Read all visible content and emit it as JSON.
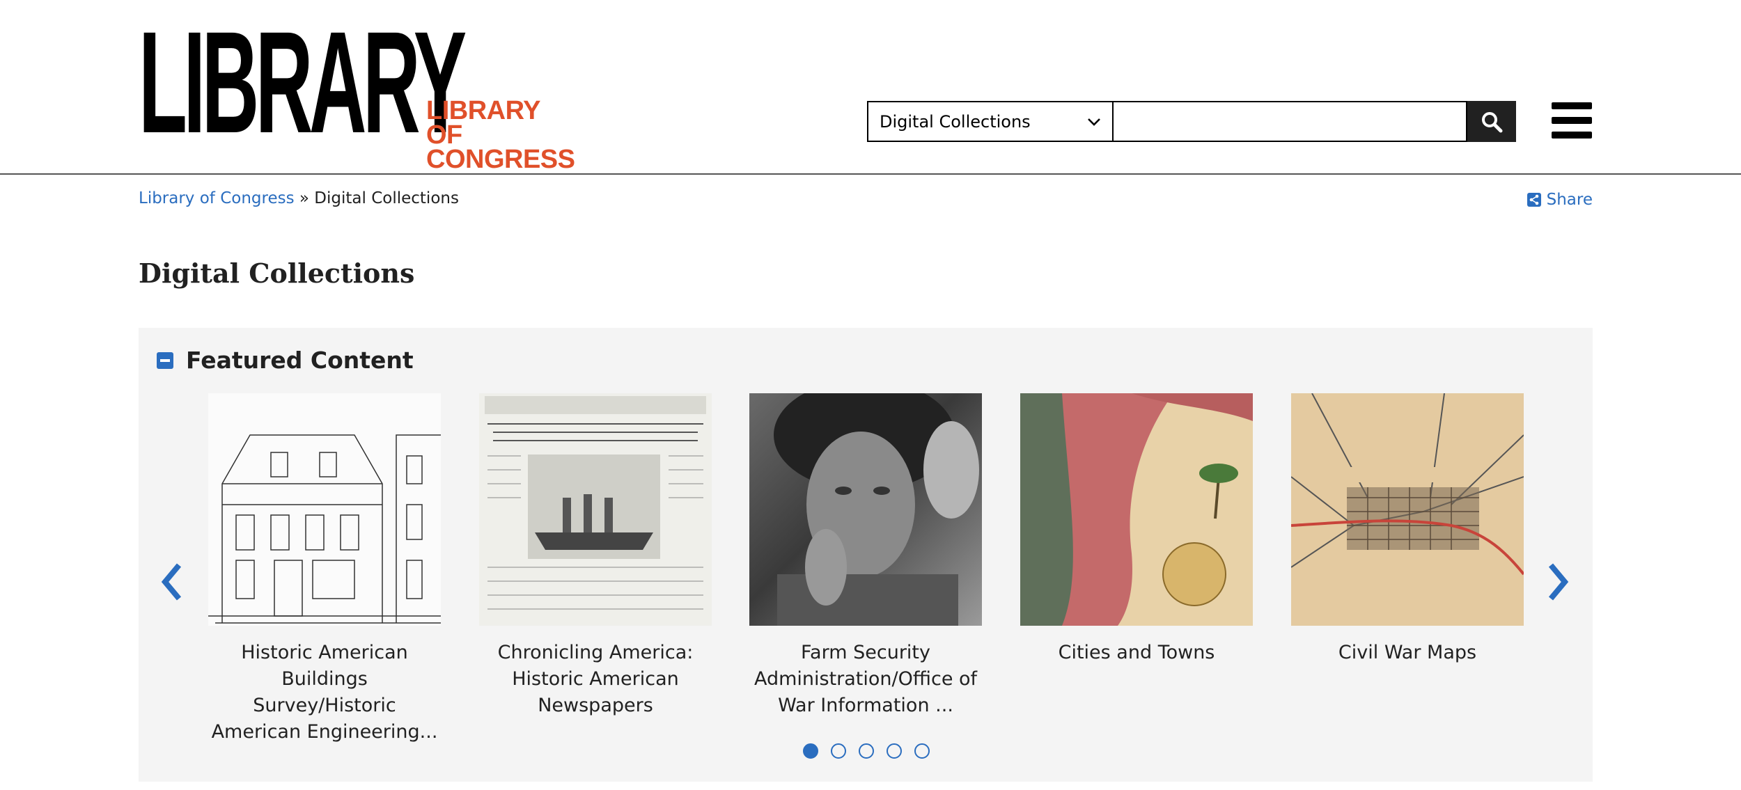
{
  "header": {
    "logo_big": "LIBRARY",
    "logo_small_line1": "LIBRARY",
    "logo_small_line2": "OF CONGRESS",
    "search_scope": "Digital Collections",
    "search_value": "",
    "colors": {
      "accent": "#2a6dbf",
      "brand_orange": "#e0502a"
    }
  },
  "breadcrumb": {
    "home": "Library of Congress",
    "separator": "»",
    "current": "Digital Collections"
  },
  "share_label": "Share",
  "page_title": "Digital Collections",
  "featured": {
    "title": "Featured Content",
    "items": [
      {
        "label": "Historic American Buildings Survey/Historic American Engineering..."
      },
      {
        "label": "Chronicling America: Historic American Newspapers"
      },
      {
        "label": "Farm Security Administration/Office of War Information ..."
      },
      {
        "label": "Cities and Towns"
      },
      {
        "label": "Civil War Maps"
      }
    ],
    "page_count": 5,
    "active_page": 1
  },
  "icons": {
    "search": "search-icon",
    "menu": "hamburger-menu-icon",
    "share": "share-icon",
    "collapse": "collapse-icon",
    "prev": "chevron-left-icon",
    "next": "chevron-right-icon"
  }
}
